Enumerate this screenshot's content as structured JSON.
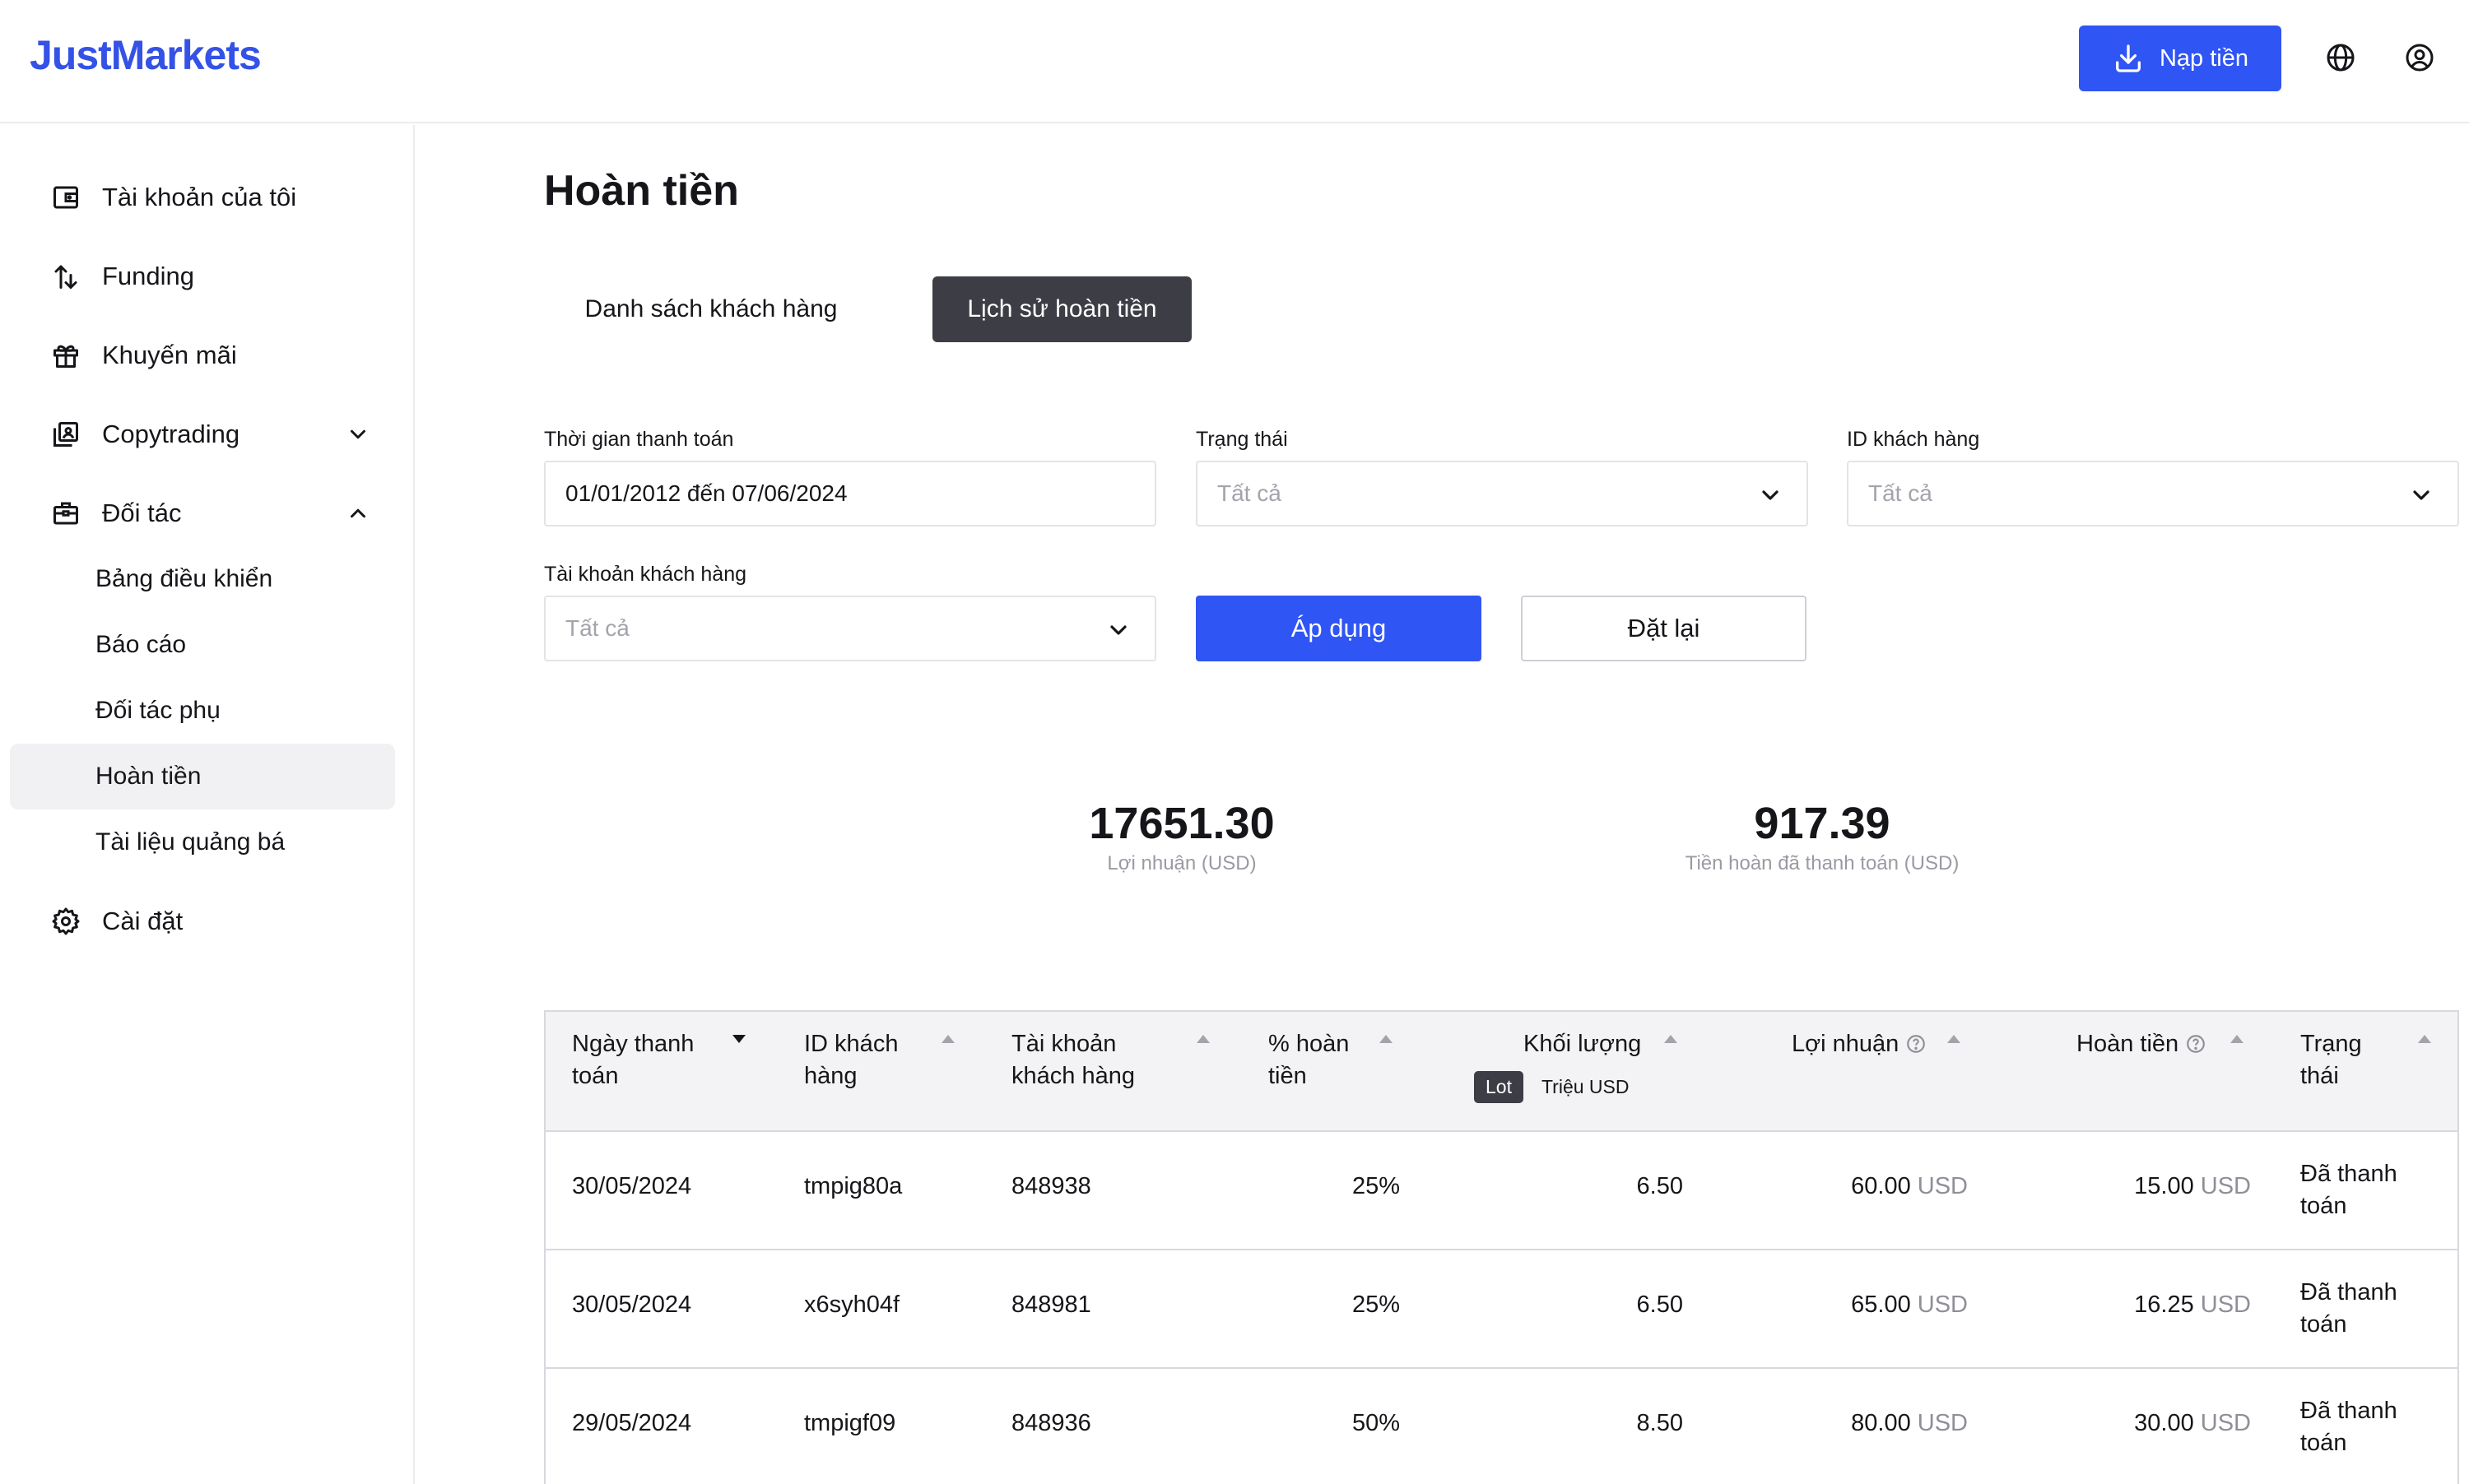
{
  "header": {
    "logo": "JustMarkets",
    "deposit_label": "Nạp tiền"
  },
  "sidebar": {
    "items": [
      {
        "label": "Tài khoản của tôi",
        "icon": "wallet-icon"
      },
      {
        "label": "Funding",
        "icon": "transfer-arrows-icon"
      },
      {
        "label": "Khuyến mãi",
        "icon": "gift-icon"
      },
      {
        "label": "Copytrading",
        "icon": "copy-portrait-icon"
      },
      {
        "label": "Đối tác",
        "icon": "briefcase-icon"
      },
      {
        "label": "Cài đặt",
        "icon": "gear-icon"
      }
    ],
    "partner_sub": [
      {
        "label": "Bảng điều khiển"
      },
      {
        "label": "Báo cáo"
      },
      {
        "label": "Đối tác phụ"
      },
      {
        "label": "Hoàn tiền"
      },
      {
        "label": "Tài liệu quảng bá"
      }
    ]
  },
  "main": {
    "title": "Hoàn tiền",
    "tabs": [
      "Danh sách khách hàng",
      "Lịch sử hoàn tiền"
    ],
    "filters": {
      "date_label": "Thời gian thanh toán",
      "date_value": "01/01/2012 đến 07/06/2024",
      "status_label": "Trạng thái",
      "status_placeholder": "Tất cả",
      "client_id_label": "ID khách hàng",
      "client_id_placeholder": "Tất cả",
      "account_label": "Tài khoản khách hàng",
      "account_placeholder": "Tất cả",
      "apply": "Áp dụng",
      "reset": "Đặt lại"
    },
    "stats": {
      "profit_value": "17651.30",
      "profit_label": "Lợi nhuận (USD)",
      "rebate_value": "917.39",
      "rebate_label": "Tiền hoàn đã thanh toán (USD)"
    },
    "table": {
      "headers": {
        "date": [
          "Ngày thanh",
          "toán"
        ],
        "client_id": [
          "ID khách",
          "hàng"
        ],
        "account": [
          "Tài khoản",
          "khách hàng"
        ],
        "percent": [
          "% hoàn",
          "tiền"
        ],
        "volume": "Khối lượng",
        "profit": "Lợi nhuận",
        "rebate": "Hoàn tiền",
        "status": [
          "Trạng",
          "thái"
        ]
      },
      "volume_units": [
        "Lot",
        "Triệu USD"
      ],
      "currency": "USD",
      "rows": [
        {
          "date": "30/05/2024",
          "client_id": "tmpig80a",
          "account": "848938",
          "percent": "25%",
          "volume": "6.50",
          "profit": "60.00",
          "rebate": "15.00",
          "status": [
            "Đã thanh",
            "toán"
          ]
        },
        {
          "date": "30/05/2024",
          "client_id": "x6syh04f",
          "account": "848981",
          "percent": "25%",
          "volume": "6.50",
          "profit": "65.00",
          "rebate": "16.25",
          "status": [
            "Đã thanh",
            "toán"
          ]
        },
        {
          "date": "29/05/2024",
          "client_id": "tmpigf09",
          "account": "848936",
          "percent": "50%",
          "volume": "8.50",
          "profit": "80.00",
          "rebate": "30.00",
          "status": [
            "Đã thanh",
            "toán"
          ]
        }
      ]
    }
  }
}
